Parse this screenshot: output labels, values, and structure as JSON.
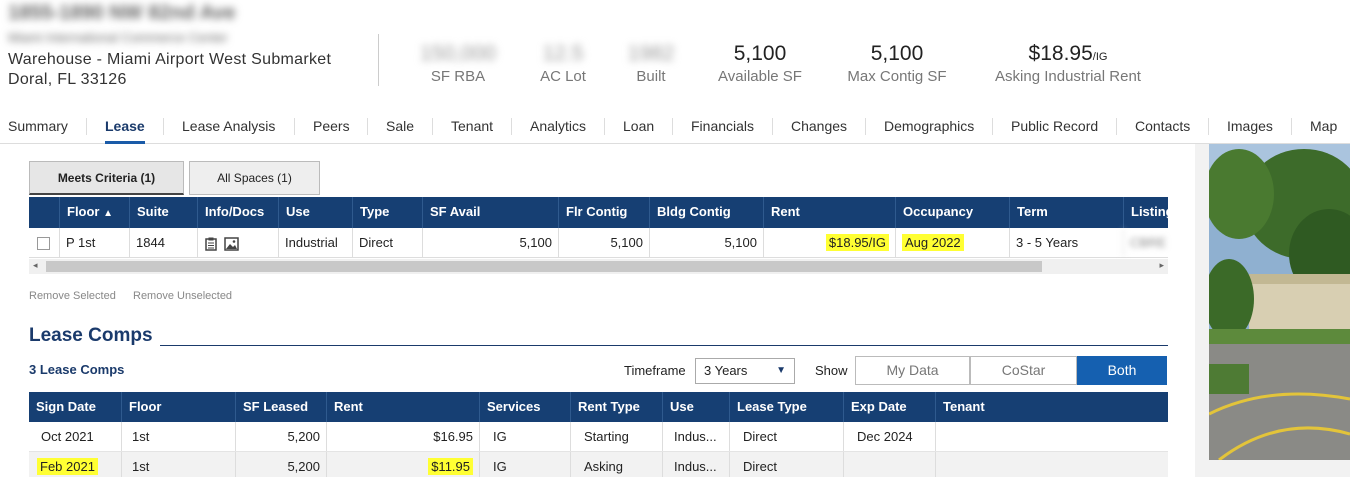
{
  "header": {
    "address_line1": "1855-1890 NW 82nd Ave",
    "address_line2": "Miami International Commerce Center",
    "property_type": "Warehouse - Miami Airport West Submarket",
    "city_line": "Doral, FL 33126",
    "stats": [
      {
        "value": "150,000",
        "label": "SF RBA",
        "blurred": true
      },
      {
        "value": "12.5",
        "label": "AC Lot",
        "blurred": true
      },
      {
        "value": "1982",
        "label": "Built",
        "blurred": true
      },
      {
        "value": "5,100",
        "label": "Available SF",
        "blurred": false
      },
      {
        "value": "5,100",
        "label": "Max Contig SF",
        "blurred": false
      },
      {
        "value": "$18.95",
        "suffix": "/IG",
        "label": "Asking Industrial Rent",
        "blurred": false
      }
    ]
  },
  "tabs": [
    "Summary",
    "Lease",
    "Lease Analysis",
    "Peers",
    "Sale",
    "Tenant",
    "Analytics",
    "Loan",
    "Financials",
    "Changes",
    "Demographics",
    "Public Record",
    "Contacts",
    "Images",
    "Map"
  ],
  "active_tab": "Lease",
  "spaces": {
    "subtabs": [
      "Meets Criteria (1)",
      "All Spaces (1)"
    ],
    "columns": [
      "Floor",
      "Suite",
      "Info/Docs",
      "Use",
      "Type",
      "SF Avail",
      "Flr Contig",
      "Bldg Contig",
      "Rent",
      "Occupancy",
      "Term",
      "Listing"
    ],
    "sort_arrow": "▲",
    "rows": [
      {
        "floor": "P 1st",
        "suite": "1844",
        "use": "Industrial",
        "type": "Direct",
        "sf_avail": "5,100",
        "flr_contig": "5,100",
        "bldg_contig": "5,100",
        "rent": "$18.95/IG",
        "occupancy": "Aug 2022",
        "term": "3 - 5 Years",
        "listing": "CBRE"
      }
    ],
    "remove_selected": "Remove Selected",
    "remove_unselected": "Remove Unselected"
  },
  "lease_comps": {
    "title": "Lease Comps",
    "count_label": "3 Lease Comps",
    "timeframe_label": "Timeframe",
    "timeframe_value": "3 Years",
    "show_label": "Show",
    "show_options": [
      "My Data",
      "CoStar",
      "Both"
    ],
    "show_selected": "Both",
    "columns": [
      "Sign Date",
      "Floor",
      "SF Leased",
      "Rent",
      "Services",
      "Rent Type",
      "Use",
      "Lease Type",
      "Exp Date",
      "Tenant"
    ],
    "rows": [
      {
        "sign_date": "Oct 2021",
        "floor": "1st",
        "sf_leased": "5,200",
        "rent": "$16.95",
        "services": "IG",
        "rent_type": "Starting",
        "use": "Indus...",
        "lease_type": "Direct",
        "exp_date": "Dec 2024",
        "tenant": ""
      },
      {
        "sign_date": "Feb 2021",
        "floor": "1st",
        "sf_leased": "5,200",
        "rent": "$11.95",
        "services": "IG",
        "rent_type": "Asking",
        "use": "Indus...",
        "lease_type": "Direct",
        "exp_date": "",
        "tenant": ""
      }
    ]
  },
  "colors": {
    "navy": "#163f73",
    "accent": "#1560b0",
    "highlight": "#ffff33"
  }
}
